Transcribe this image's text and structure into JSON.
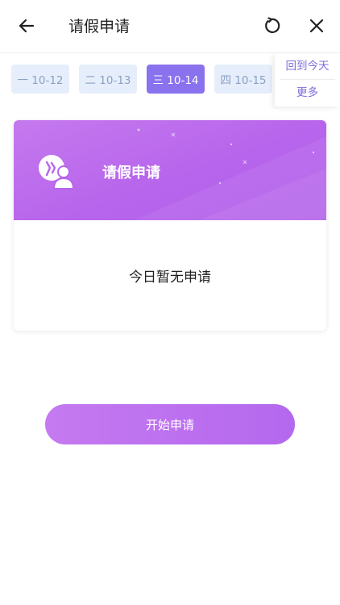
{
  "header": {
    "title": "请假申请",
    "back_icon": "arrow-left-icon",
    "refresh_icon": "refresh-icon",
    "close_icon": "close-icon"
  },
  "dates": [
    {
      "label": "一 10-12",
      "selected": false
    },
    {
      "label": "二 10-13",
      "selected": false
    },
    {
      "label": "三 10-14",
      "selected": true
    },
    {
      "label": "四 10-15",
      "selected": false
    }
  ],
  "today_panel": {
    "today_label": "回到今天",
    "more_label": "更多"
  },
  "card": {
    "title": "请假申请",
    "icon": "leave-user-icon",
    "empty_text": "今日暂无申请"
  },
  "actions": {
    "start_label": "开始申请"
  },
  "colors": {
    "accent": "#8a72ee",
    "card_header": "#b765ec",
    "chip_bg": "#e6eefb",
    "chip_text": "#8aa0c6",
    "link": "#7e6dd9"
  }
}
